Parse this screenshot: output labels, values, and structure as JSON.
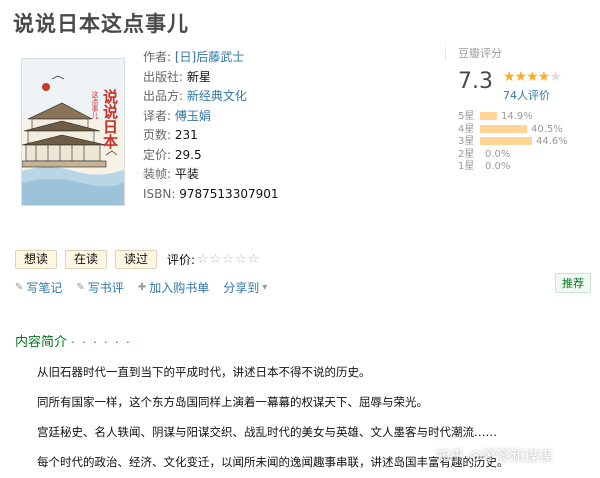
{
  "title": "说说日本这点事儿",
  "cover": {
    "title_text": "说说日本",
    "subtitle_text": "这点事儿"
  },
  "info": {
    "author_label": "作者:",
    "author_value": "[日]后藤武士",
    "publisher_label": "出版社:",
    "publisher_value": "新星",
    "producer_label": "出品方:",
    "producer_value": "新经典文化",
    "translator_label": "译者:",
    "translator_value": "傅玉娟",
    "pages_label": "页数:",
    "pages_value": "231",
    "price_label": "定价:",
    "price_value": "29.5",
    "binding_label": "装帧:",
    "binding_value": "平装",
    "isbn_label": "ISBN:",
    "isbn_value": "9787513307901"
  },
  "rating": {
    "title": "豆瓣评分",
    "score": "7.3",
    "stars_on": "★★★★",
    "stars_off": "★",
    "votes": "74人评价",
    "distribution": [
      {
        "label": "5星",
        "percent": 14.9,
        "text": "14.9%"
      },
      {
        "label": "4星",
        "percent": 40.5,
        "text": "40.5%"
      },
      {
        "label": "3星",
        "percent": 44.6,
        "text": "44.6%"
      },
      {
        "label": "2星",
        "percent": 0.0,
        "text": "0.0%"
      },
      {
        "label": "1星",
        "percent": 0.0,
        "text": "0.0%"
      }
    ]
  },
  "actions": {
    "want": "想读",
    "reading": "在读",
    "read": "读过",
    "rate_label": "评价:",
    "rate_stars": "☆☆☆☆☆"
  },
  "utils": {
    "note": "写笔记",
    "review": "写书评",
    "cart": "加入购书单",
    "share": "分享到",
    "recommend": "推荐"
  },
  "intro": {
    "heading": "内容简介",
    "dots": "· · · · · ·",
    "paragraphs": [
      "从旧石器时代一直到当下的平成时代，讲述日本不得不说的历史。",
      "同所有国家一样，这个东方岛国同样上演着一幕幕的权谋天下、屈辱与荣光。",
      "宫廷秘史、名人轶闻、阴谋与阳谋交织、战乱时代的美女与英雄、文人墨客与时代潮流……",
      "每个时代的政治、经济、文化变迁，以闻所未闻的逸闻趣事串联，讲述岛国丰富有趣的历史。"
    ]
  },
  "watermark": "知乎 @寥寥和谋谋",
  "colors": {
    "link": "#3377aa",
    "green": "#007722",
    "star": "#ffac2d",
    "bar": "#ffd596"
  }
}
